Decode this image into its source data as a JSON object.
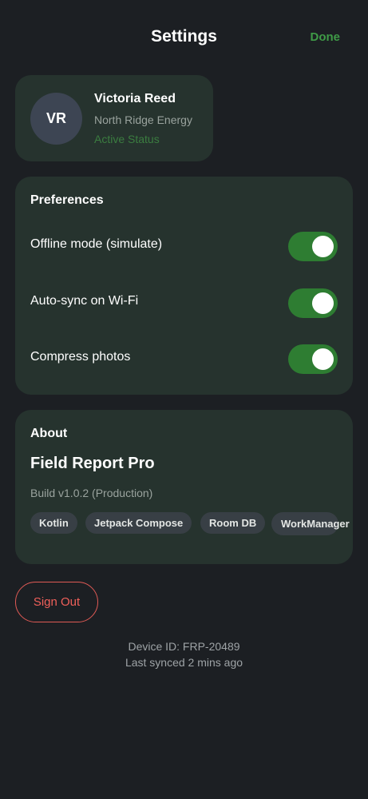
{
  "header": {
    "title": "Settings",
    "done_label": "Done"
  },
  "profile": {
    "initials": "VR",
    "name": "Victoria Reed",
    "company": "North Ridge Energy",
    "status": "Active Status"
  },
  "preferences": {
    "heading": "Preferences",
    "items": [
      {
        "label": "Offline mode (simulate)",
        "enabled": true
      },
      {
        "label": "Auto-sync on Wi-Fi",
        "enabled": true
      },
      {
        "label": "Compress photos",
        "enabled": true
      }
    ]
  },
  "about": {
    "heading": "About",
    "app_name": "Field Report Pro",
    "build": "Build v1.0.2 (Production)",
    "chips": [
      "Kotlin",
      "Jetpack Compose",
      "Room DB",
      "WorkManager"
    ]
  },
  "actions": {
    "sign_out_label": "Sign Out"
  },
  "footer": {
    "device_id": "Device ID: FRP-20489",
    "last_synced": "Last synced 2 mins ago"
  },
  "colors": {
    "background": "#1c1f23",
    "card": "#26332e",
    "accent_green": "#3f9b47",
    "toggle_on": "#2e7d32",
    "danger": "#e05a55"
  }
}
